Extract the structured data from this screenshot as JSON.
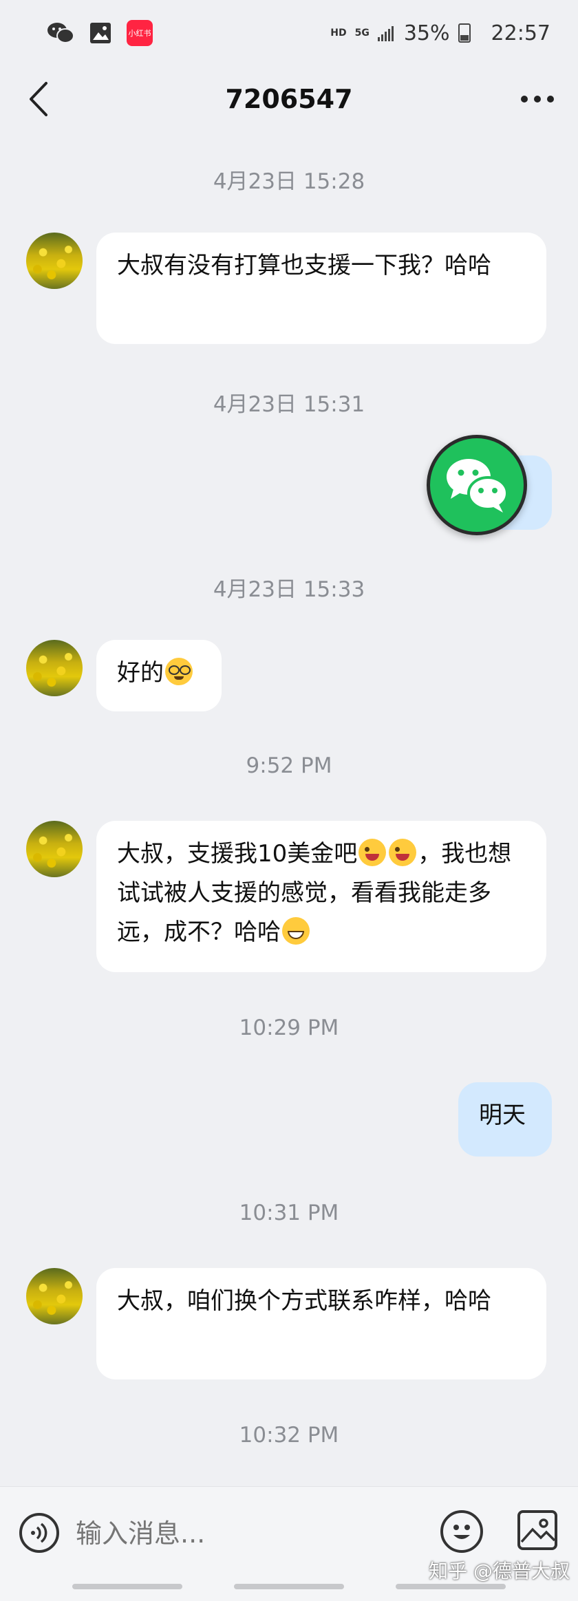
{
  "status_bar": {
    "network_hd": "HD",
    "network_5g": "5G",
    "battery": "35%",
    "time": "22:57",
    "notification_badge": "小红书"
  },
  "header": {
    "title": "7206547"
  },
  "messages": [
    {
      "type": "time",
      "text": "4月23日 15:28"
    },
    {
      "type": "received",
      "text": "大叔有没有打算也支援一下我？哈哈"
    },
    {
      "type": "time",
      "text": "4月23日 15:31"
    },
    {
      "type": "sent",
      "text": "",
      "note": "covered by floating WeChat icon"
    },
    {
      "type": "time",
      "text": "4月23日 15:33"
    },
    {
      "type": "received",
      "text": "好的",
      "emoji": "nerd-face"
    },
    {
      "type": "time",
      "text": "9:52 PM"
    },
    {
      "type": "received",
      "text_parts": [
        "大叔，支援我10美金吧",
        "，我也想试试被人支援的感觉，看看我能走多远，成不？哈哈"
      ],
      "emoji": [
        "winking-tongue",
        "winking-tongue",
        "grinning-face"
      ]
    },
    {
      "type": "time",
      "text": "10:29 PM"
    },
    {
      "type": "sent",
      "text": "明天"
    },
    {
      "type": "time",
      "text": "10:31 PM"
    },
    {
      "type": "received",
      "text": "大叔，咱们换个方式联系咋样，哈哈"
    },
    {
      "type": "time",
      "text": "10:32 PM"
    }
  ],
  "input_bar": {
    "placeholder": "输入消息..."
  },
  "watermark": "知乎 @德普大叔",
  "colors": {
    "background": "#eff0f3",
    "received_bubble": "#ffffff",
    "sent_bubble": "#d3e9fe",
    "timestamp": "#8a8d93",
    "wechat_green": "#1fc15c"
  }
}
